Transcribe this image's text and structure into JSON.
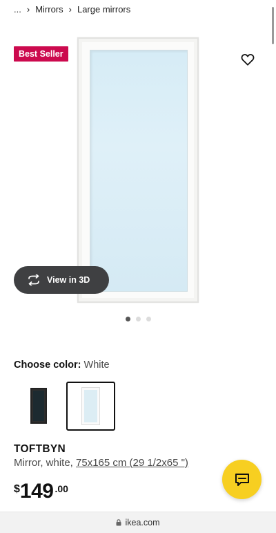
{
  "breadcrumb": {
    "ellipsis": "...",
    "items": [
      "Mirrors",
      "Large mirrors"
    ]
  },
  "product": {
    "badge": "Best Seller",
    "view_3d_label": "View in 3D",
    "image_dots": 3,
    "active_dot": 0,
    "choose_color_label": "Choose color:",
    "choose_color_value": "White",
    "color_options": [
      "Black",
      "White"
    ],
    "selected_color": "White",
    "name": "TOFTBYN",
    "description_prefix": "Mirror, white, ",
    "description_size": "75x165 cm (29 1/2x65 \")",
    "price": {
      "currency": "$",
      "integer": "149",
      "decimal": ".00"
    }
  },
  "browser": {
    "domain": "ikea.com"
  },
  "icons": {
    "favorite": "heart-outline-icon",
    "view_3d": "rotate-3d-icon",
    "chat": "chat-bubble-icon",
    "lock": "lock-icon"
  },
  "colors": {
    "badge_bg": "#cc0a4e",
    "chat_bg": "#f7cf21",
    "view3d_bg": "#3f4042"
  }
}
